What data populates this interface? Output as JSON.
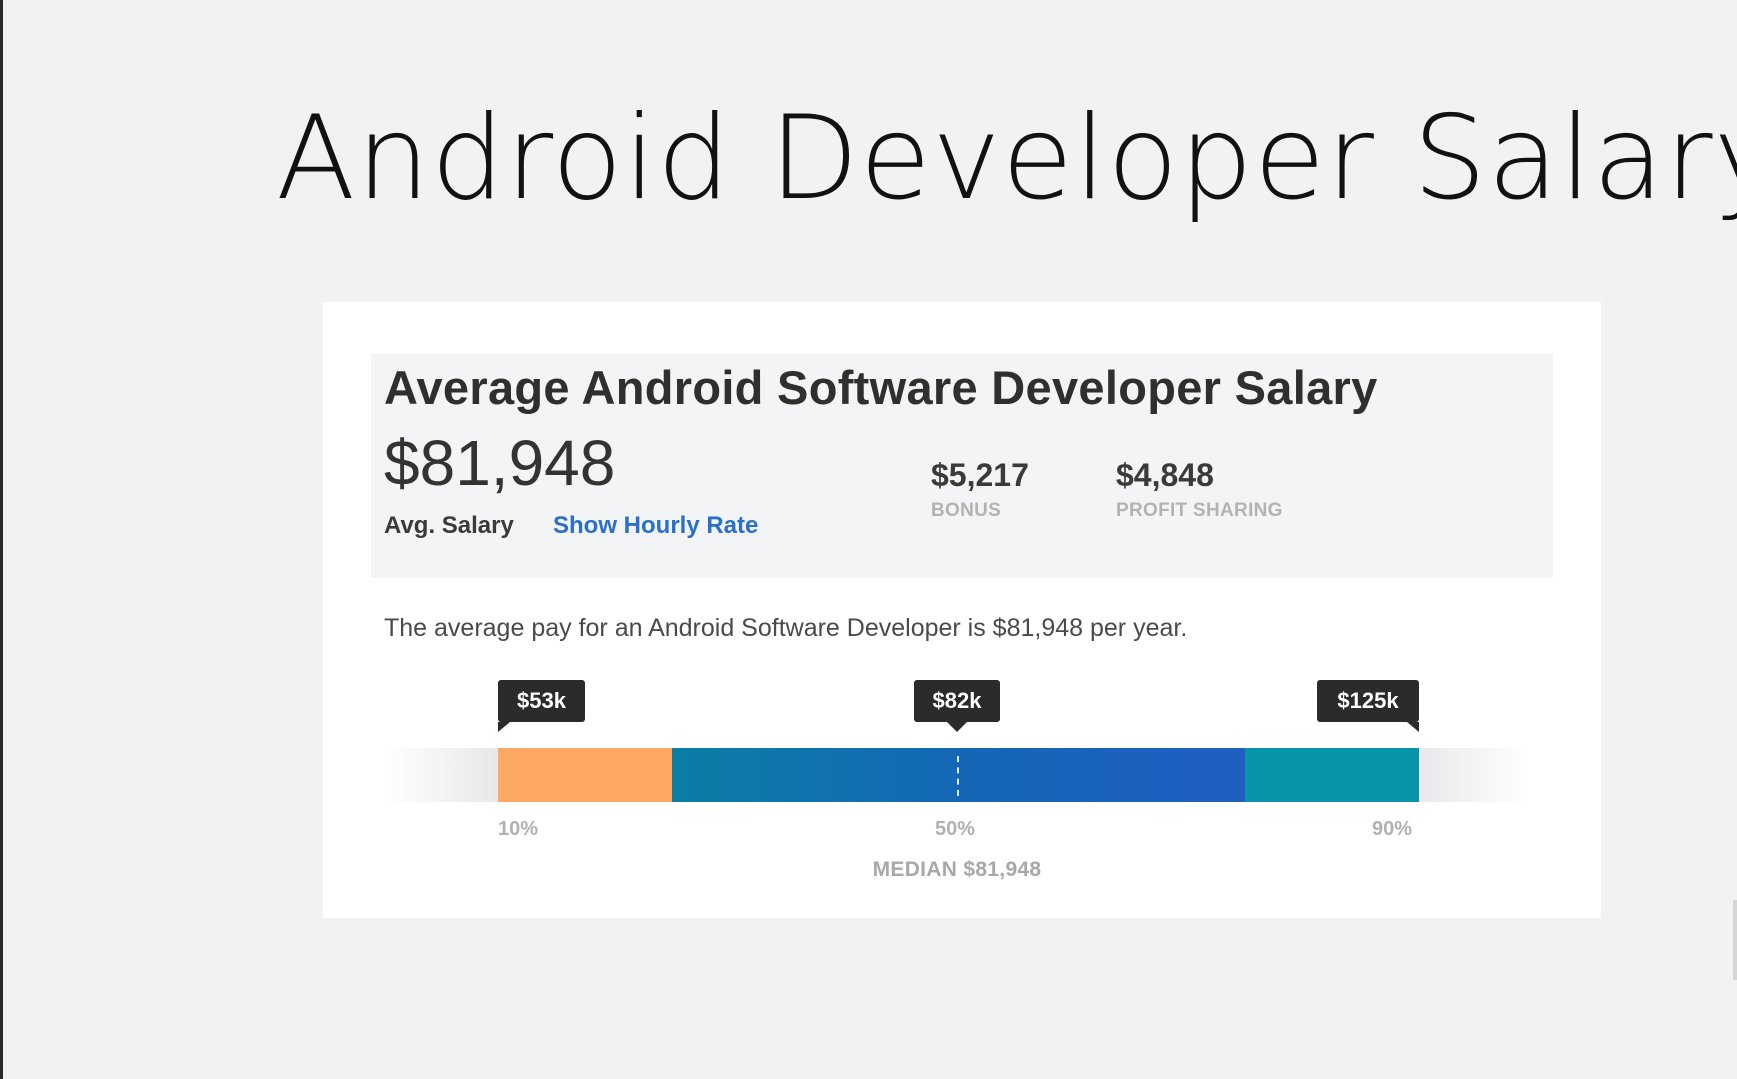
{
  "slide": {
    "title": "Android Developer Salary"
  },
  "card": {
    "title": "Average Android Software Developer Salary",
    "avg_salary": "$81,948",
    "avg_salary_label": "Avg. Salary",
    "hourly_link": "Show Hourly Rate",
    "bonus": {
      "value": "$5,217",
      "label": "BONUS"
    },
    "profit_sharing": {
      "value": "$4,848",
      "label": "PROFIT SHARING"
    },
    "summary_sentence": "The average pay for an Android Software Developer is $81,948 per year.",
    "range": {
      "tooltips": {
        "p10": "$53k",
        "p50": "$82k",
        "p90": "$125k"
      },
      "percentile_labels": {
        "p10": "10%",
        "p50": "50%",
        "p90": "90%"
      },
      "median_label": "MEDIAN $81,948"
    }
  },
  "colors": {
    "lower_segment": "#fda965",
    "middle_segment": "#1565b8",
    "upper_segment": "#0894aa",
    "link": "#2a6fc9",
    "tooltip": "#2b2b2b"
  }
}
